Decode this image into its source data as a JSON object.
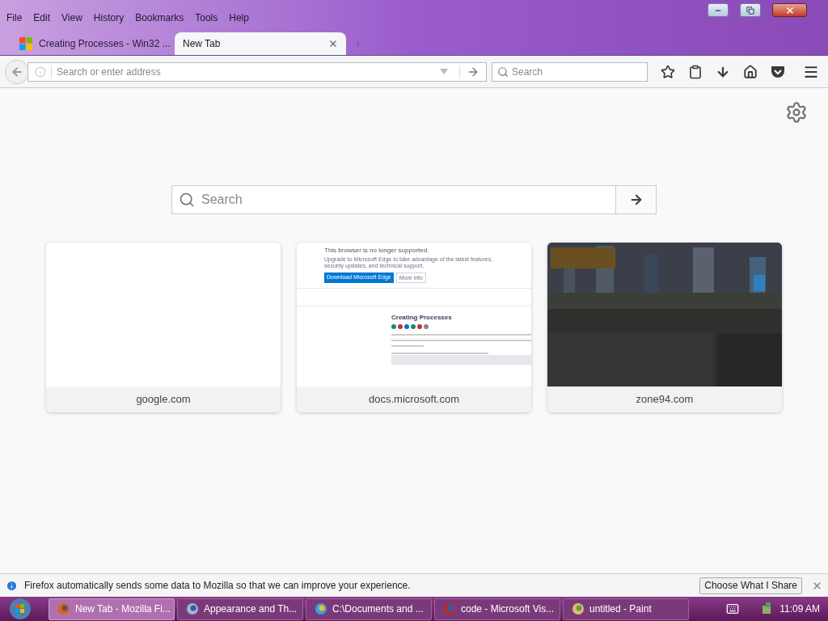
{
  "menu": [
    "File",
    "Edit",
    "View",
    "History",
    "Bookmarks",
    "Tools",
    "Help"
  ],
  "tabs": [
    {
      "title": "Creating Processes - Win32 ...",
      "selected": false,
      "kind": "windows"
    },
    {
      "title": "New Tab",
      "selected": true,
      "kind": "blank"
    }
  ],
  "address_bar": {
    "placeholder": "Search or enter address"
  },
  "search_bar": {
    "placeholder": "Search"
  },
  "page_search": {
    "placeholder": "Search"
  },
  "tiles": [
    {
      "label": "google.com",
      "kind": "blank"
    },
    {
      "label": "docs.microsoft.com",
      "kind": "docs",
      "banner_title": "This browser is no longer supported.",
      "banner_text": "Upgrade to Microsoft Edge to take advantage of the latest features, security updates, and technical support.",
      "primary_button": "Download Microsoft Edge",
      "secondary_button": "More info",
      "article_title": "Creating Processes"
    },
    {
      "label": "zone94.com",
      "kind": "picture"
    }
  ],
  "notification": {
    "text": "Firefox automatically sends some data to Mozilla so that we can improve your experience.",
    "button": "Choose What I Share"
  },
  "taskbar": {
    "items": [
      {
        "label": "New Tab - Mozilla Fi...",
        "selected": true,
        "kind": "firefox"
      },
      {
        "label": "Appearance and Th...",
        "selected": false,
        "kind": "control"
      },
      {
        "label": "C:\\Documents and ...",
        "selected": false,
        "kind": "ie"
      },
      {
        "label": "code - Microsoft Vis...",
        "selected": false,
        "kind": "vs"
      },
      {
        "label": "untitled - Paint",
        "selected": false,
        "kind": "paint"
      }
    ],
    "clock": "11:09 AM"
  }
}
